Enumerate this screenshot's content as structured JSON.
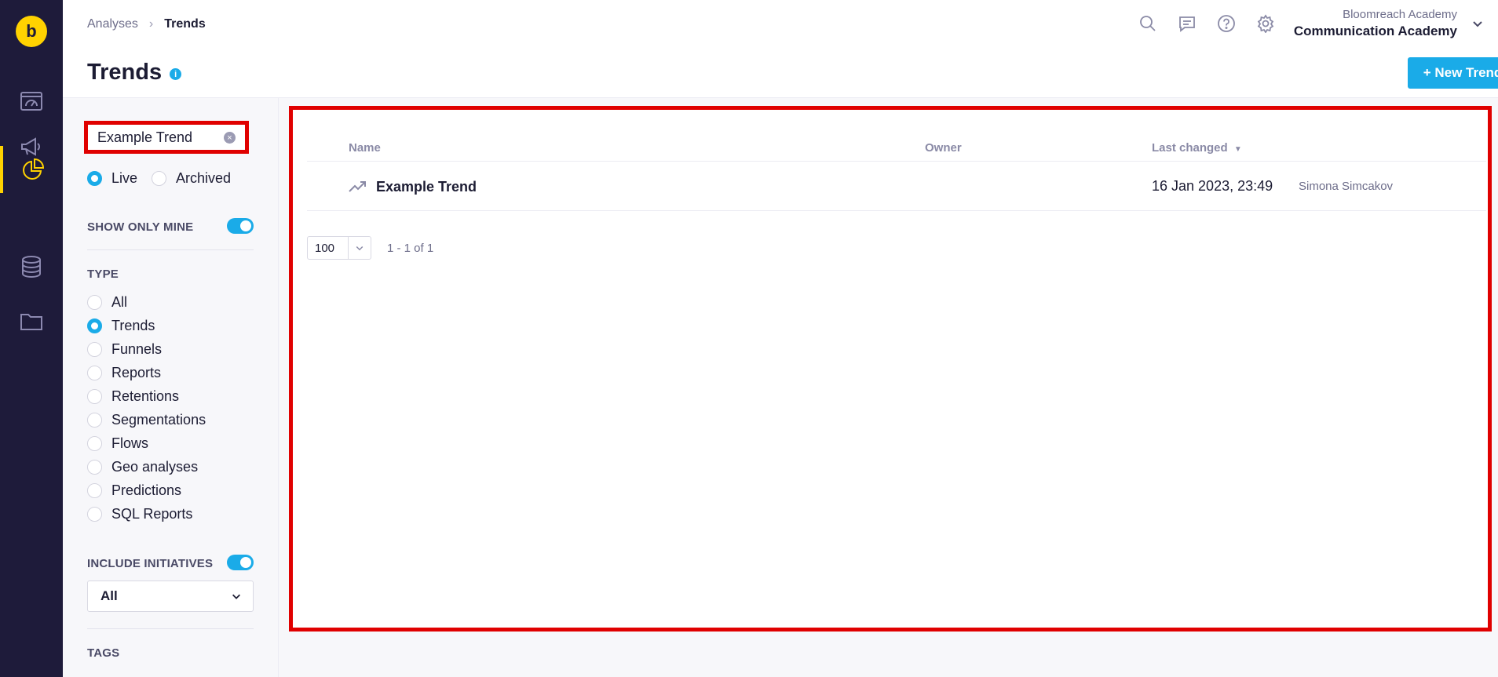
{
  "app": {
    "brand_colors": {
      "rail": "#1e1b3a",
      "accent": "#ffd200",
      "primary": "#1aabe8",
      "highlight": "#e00000"
    },
    "logo_icon": "bloomreach-logo-icon"
  },
  "rail": {
    "items": [
      {
        "name": "dashboard-icon",
        "active": false
      },
      {
        "name": "megaphone-icon",
        "active": false
      },
      {
        "name": "pie-chart-icon",
        "active": true
      },
      {
        "name": "database-icon",
        "active": false
      },
      {
        "name": "folder-icon",
        "active": false
      }
    ]
  },
  "header": {
    "breadcrumb": [
      "Analyses",
      "Trends"
    ],
    "title": "Trends",
    "info_icon": "i",
    "icons": [
      "search-icon",
      "chat-icon",
      "help-icon",
      "gear-icon"
    ],
    "account": {
      "org": "Bloomreach Academy",
      "project": "Communication Academy"
    },
    "new_button": "+ New Trend"
  },
  "filters": {
    "search_value": "Example Trend",
    "status": {
      "live": "Live",
      "archived": "Archived",
      "selected": "Live"
    },
    "show_only_mine": {
      "label": "SHOW ONLY MINE",
      "on": true
    },
    "type": {
      "label": "TYPE",
      "options": [
        "All",
        "Trends",
        "Funnels",
        "Reports",
        "Retentions",
        "Segmentations",
        "Flows",
        "Geo analyses",
        "Predictions",
        "SQL Reports"
      ],
      "selected": "Trends"
    },
    "include_initiatives": {
      "label": "INCLUDE INITIATIVES",
      "on": true,
      "value": "All"
    },
    "tags_label": "TAGS"
  },
  "table": {
    "columns": {
      "name": "Name",
      "owner": "Owner",
      "last_changed": "Last changed"
    },
    "rows": [
      {
        "icon": "trend-icon",
        "name": "Example Trend",
        "owner": "",
        "last_changed": "16 Jan 2023, 23:49",
        "author": "Simona Simcakov"
      }
    ],
    "page_size": "100",
    "range": "1 - 1 of 1"
  }
}
